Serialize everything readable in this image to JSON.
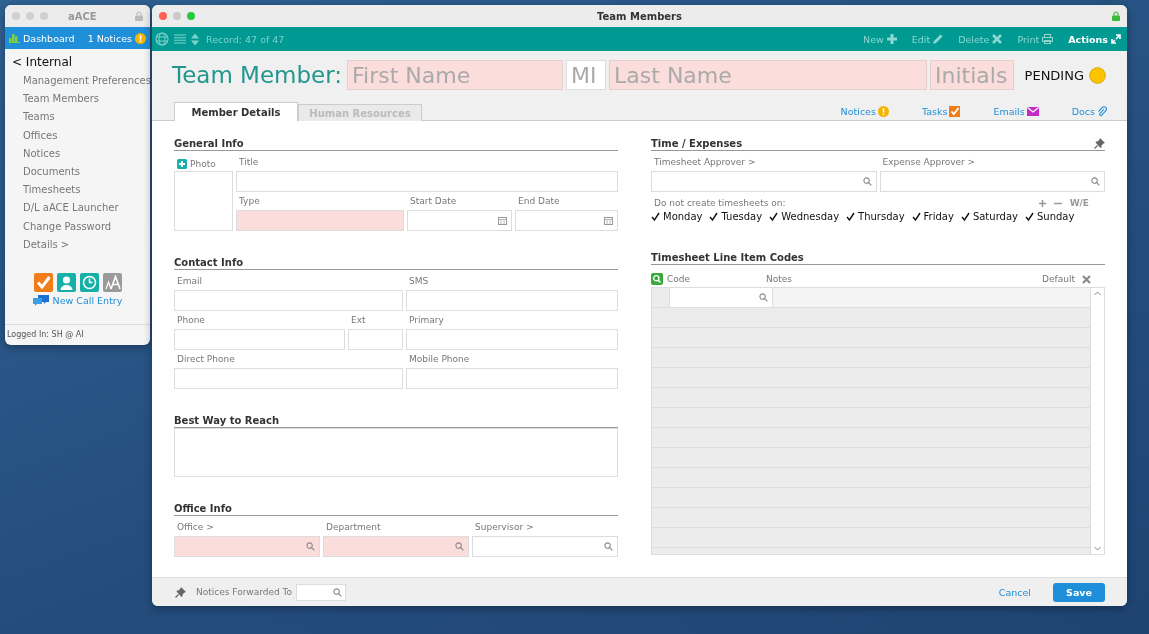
{
  "launcher": {
    "title": "aACE",
    "dashboard": "Dashboard",
    "notices": "1 Notices",
    "back": "< Internal",
    "items": [
      "Management Preferences",
      "Team Members",
      "Teams",
      "Offices",
      "Notices",
      "Documents",
      "Timesheets",
      "D/L aACE Launcher",
      "Change Password",
      "Details >"
    ],
    "new_call": "New Call Entry",
    "status": "Logged In: SH @ AI"
  },
  "window": {
    "title": "Team Members"
  },
  "toolbar": {
    "record": "Record: 47 of 47",
    "actions": [
      {
        "label": "New",
        "kind": "new",
        "disabled": true
      },
      {
        "label": "Edit",
        "kind": "edit",
        "disabled": true
      },
      {
        "label": "Delete",
        "kind": "delete",
        "disabled": true
      },
      {
        "label": "Print",
        "kind": "print",
        "disabled": true
      },
      {
        "label": "Actions",
        "kind": "actions",
        "disabled": false
      }
    ]
  },
  "header": {
    "label": "Team Member:",
    "name_fields": [
      {
        "placeholder": "First Name",
        "required": true
      },
      {
        "placeholder": "MI",
        "required": false
      },
      {
        "placeholder": "Last Name",
        "required": true
      },
      {
        "placeholder": "Initials",
        "required": true
      }
    ],
    "status": "PENDING"
  },
  "tabs": [
    {
      "label": "Member Details",
      "selected": true
    },
    {
      "label": "Human Resources",
      "selected": false
    }
  ],
  "related": [
    {
      "label": "Notices",
      "kind": "notices"
    },
    {
      "label": "Tasks",
      "kind": "tasks"
    },
    {
      "label": "Emails",
      "kind": "emails"
    },
    {
      "label": "Docs",
      "kind": "docs"
    }
  ],
  "general_info": {
    "title": "General Info",
    "photo": "Photo",
    "fields": [
      {
        "label": "Title",
        "kind": "text",
        "required": false
      },
      {
        "label": "Type",
        "kind": "text",
        "required": true
      },
      {
        "label": "Start Date",
        "kind": "date",
        "required": false
      },
      {
        "label": "End Date",
        "kind": "date",
        "required": false
      }
    ]
  },
  "contact_info": {
    "title": "Contact Info",
    "fields": [
      {
        "label": "Email",
        "kind": "text",
        "required": false
      },
      {
        "label": "SMS",
        "kind": "text",
        "required": false
      },
      {
        "label": "Phone",
        "kind": "text",
        "required": false
      },
      {
        "label": "Ext",
        "kind": "text",
        "required": false
      },
      {
        "label": "Primary",
        "kind": "text",
        "required": false
      },
      {
        "label": "Direct Phone",
        "kind": "text",
        "required": false
      },
      {
        "label": "Mobile Phone",
        "kind": "text",
        "required": false
      }
    ]
  },
  "best_way": {
    "title": "Best Way to Reach"
  },
  "office_info": {
    "title": "Office Info",
    "fields": [
      {
        "label": "Office >",
        "kind": "lookup",
        "required": true
      },
      {
        "label": "Department",
        "kind": "lookup",
        "required": true
      },
      {
        "label": "Supervisor >",
        "kind": "lookup",
        "required": false
      }
    ]
  },
  "time_expenses": {
    "title": "Time / Expenses",
    "fields": [
      {
        "label": "Timesheet Approver >",
        "kind": "lookup",
        "required": false
      },
      {
        "label": "Expense Approver >",
        "kind": "lookup",
        "required": false
      }
    ],
    "days_label": "Do not create timesheets on:",
    "weekend_label": "W/E",
    "days": [
      {
        "label": "Monday",
        "checked": true
      },
      {
        "label": "Tuesday",
        "checked": true
      },
      {
        "label": "Wednesday",
        "checked": true
      },
      {
        "label": "Thursday",
        "checked": true
      },
      {
        "label": "Friday",
        "checked": true
      },
      {
        "label": "Saturday",
        "checked": true
      },
      {
        "label": "Sunday",
        "checked": true
      }
    ]
  },
  "line_item_codes": {
    "title": "Timesheet Line Item Codes",
    "columns": [
      "Code",
      "Notes",
      "Default"
    ]
  },
  "footer": {
    "forward_label": "Notices Forwarded To",
    "cancel": "Cancel",
    "save": "Save"
  }
}
